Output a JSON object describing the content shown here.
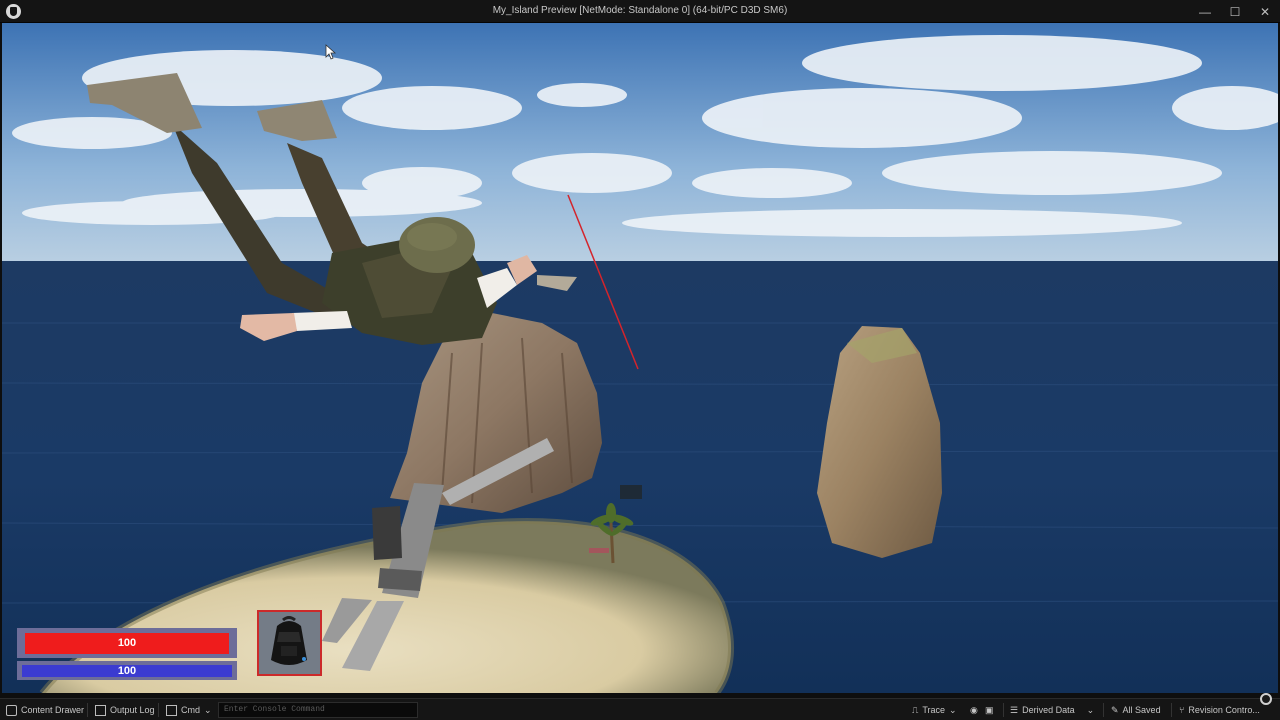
{
  "window": {
    "title": "My_Island Preview [NetMode: Standalone 0]  (64-bit/PC D3D SM6)",
    "controls": [
      "—",
      "☐",
      "✕"
    ]
  },
  "hud": {
    "health": {
      "value": "100",
      "fraction": 1.0,
      "color": "#ef1c1c"
    },
    "shield": {
      "value": "100",
      "fraction": 1.0,
      "color": "#3b3bd1"
    },
    "inventory_slot": {
      "item_icon": "backpack-icon",
      "border_color": "#cc2a2a"
    }
  },
  "statusbar": {
    "content_drawer": "Content Drawer",
    "output_log": "Output Log",
    "cmd": "Cmd",
    "console_placeholder": "Enter Console Command",
    "trace": "Trace",
    "derived_data": "Derived Data",
    "all_saved": "All Saved",
    "revision_control": "Revision Contro..."
  }
}
